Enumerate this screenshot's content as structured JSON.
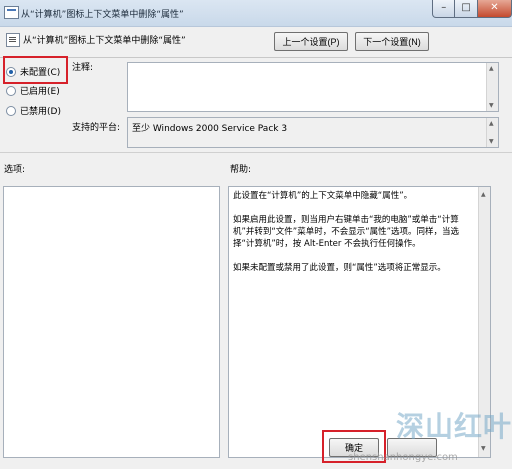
{
  "window": {
    "title": "从“计算机”图标上下文菜单中删除“属性”",
    "min_label": "–",
    "max_label": "□",
    "close_label": "✕"
  },
  "header": {
    "policy_title": "从“计算机”图标上下文菜单中删除“属性”",
    "prev_button": "上一个设置(P)",
    "next_button": "下一个设置(N)"
  },
  "state": {
    "options": [
      {
        "label": "未配置(C)",
        "selected": true
      },
      {
        "label": "已启用(E)",
        "selected": false
      },
      {
        "label": "已禁用(D)",
        "selected": false
      }
    ]
  },
  "comment": {
    "label": "注释:",
    "value": ""
  },
  "platform": {
    "label": "支持的平台:",
    "value": "至少 Windows 2000 Service Pack 3"
  },
  "options_panel": {
    "label": "选项:"
  },
  "help_panel": {
    "label": "帮助:",
    "paragraphs": [
      "此设置在“计算机”的上下文菜单中隐藏“属性”。",
      "如果启用此设置，则当用户右键单击“我的电脑”或单击“计算机”并转到“文件”菜单时，不会显示“属性”选项。同样，当选择“计算机”时，按 Alt-Enter 不会执行任何操作。",
      "如果未配置或禁用了此设置，则“属性”选项将正常显示。"
    ]
  },
  "footer": {
    "ok_button": "确定",
    "cancel_button": ""
  },
  "watermark": {
    "text_cn": "深山红叶",
    "url": "shenshanhongye.com"
  },
  "colors": {
    "highlight": "#d6212a",
    "titlebar": "#c9d9ea"
  }
}
